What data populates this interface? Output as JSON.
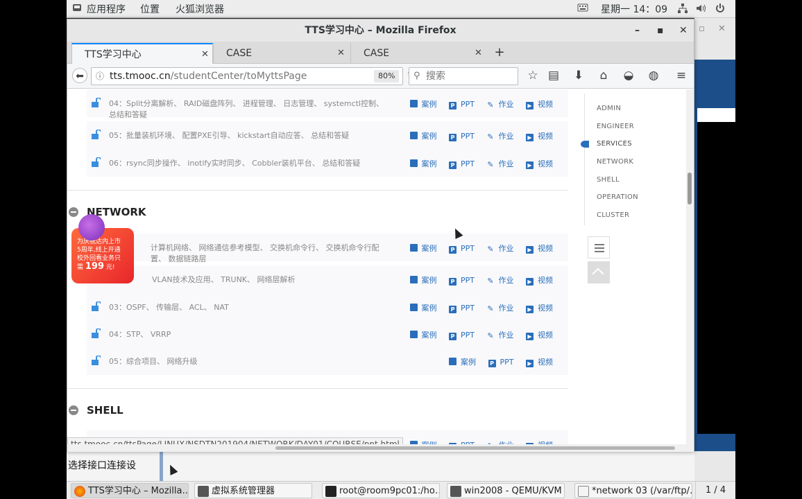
{
  "topbar": {
    "apps": "应用程序",
    "places": "位置",
    "browser": "火狐浏览器",
    "clock": "星期一 14：09"
  },
  "window": {
    "title": "TTS学习中心 – Mozilla Firefox"
  },
  "tabs": [
    {
      "label": "TTS学习中心"
    },
    {
      "label": "CASE"
    },
    {
      "label": "CASE"
    }
  ],
  "navbar": {
    "url_domain": "tts.tmooc.cn",
    "url_path": "/studentCenter/toMyttsPage",
    "zoom": "80%",
    "search_placeholder": "搜索"
  },
  "actions": {
    "case": "案例",
    "ppt": "PPT",
    "homework": "作业",
    "video": "视频"
  },
  "lessons_top": [
    {
      "text": "04：Split分离解析、 RAID磁盘阵列、 进程管理、 日志管理、 systemctl控制、 总结和答疑"
    },
    {
      "text": "05：批量装机环境、 配置PXE引导、 kickstart自动应答、 总结和答疑"
    },
    {
      "text": "06：rsync同步操作、 inotify实时同步、 Cobbler装机平台、 总结和答疑"
    }
  ],
  "sections": {
    "network": "NETWORK",
    "shell": "SHELL"
  },
  "network_lessons": [
    {
      "text": "计算机网络、 网络通信参考模型、 交换机命令行、 交换机命令行配置、 数据链路层"
    },
    {
      "text": "VLAN技术及应用、 TRUNK、 网络层解析"
    },
    {
      "text": "03：OSPF、 传输层、 ACL、 NAT"
    },
    {
      "text": "04：STP、 VRRP"
    },
    {
      "text": "05：综合项目、 网络升级"
    }
  ],
  "promo": {
    "line1": "为庆祝达内上市",
    "line2": "5周年,线上开通",
    "line3": "校外回看业务只",
    "price_prefix": "需",
    "price": "199",
    "price_suffix": "元!"
  },
  "right_nav": [
    "ADMIN",
    "ENGINEER",
    "SERVICES",
    "NETWORK",
    "SHELL",
    "OPERATION",
    "CLUSTER"
  ],
  "status_url": "tts.tmooc.cn/ttsPage/LINUX/NSDTN201904/NETWORK/DAY01/COURSE/ppt.html",
  "behind_text": "选择接口连接设",
  "taskbar": [
    {
      "label": "TTS学习中心 – Mozilla…"
    },
    {
      "label": "虚拟系统管理器"
    },
    {
      "label": "root@room9pc01:/ho…"
    },
    {
      "label": "win2008 - QEMU/KVM"
    },
    {
      "label": "*network 03 (/var/ftp/…"
    }
  ],
  "pager": "1 / 4",
  "colors": {
    "accent": "#2a6ebb",
    "tab_highlight": "#0a84ff",
    "promo": "#e8262b"
  }
}
